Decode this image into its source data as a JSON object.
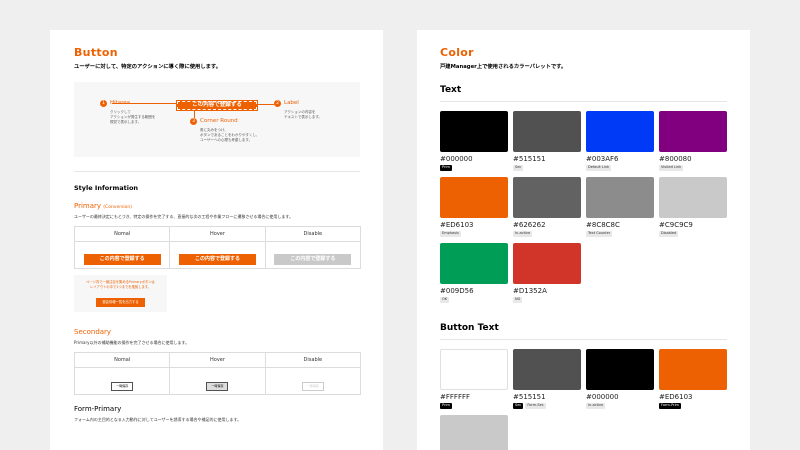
{
  "left": {
    "title": "Button",
    "subtitle": "ユーザーに対して、特定のアクションに導く際に使用します。",
    "demo": {
      "button_label": "この内容で登録する",
      "annotations": [
        {
          "num": "1",
          "title": "Hitarea",
          "desc": "クリックして\nアクションが発生する範囲を\n視覚で表示します。"
        },
        {
          "num": "2",
          "title": "Label",
          "desc": "アクションの内容を\nテキストで表示します。"
        },
        {
          "num": "3",
          "title": "Corner Round",
          "desc": "角に丸みをつけ、\nボタンであることをわかりやすくし、\nユーザーへの心理も考慮します。"
        }
      ]
    },
    "style_info": "Style Information",
    "primary": {
      "title": "Primary",
      "title_note": "(Conversion)",
      "desc": "ユーザーの最終決定にもとづき、特定の操作を完了する、直接的な次の工程や作業フローに遷移させる場合に使用します。",
      "headers": [
        "Nomal",
        "Hover",
        "Disable"
      ],
      "button_label": "この内容で登録する",
      "note": "ページ内で一番注目を集めるPrimaryボタンは\nレイアウトの中で1つまでを推奨します。",
      "note_button": "退会情報一覧を出力する"
    },
    "secondary": {
      "title": "Secondary",
      "desc": "Primary以外の補助機能の操作を完了させる場合に使用します。",
      "headers": [
        "Nomal",
        "Hover",
        "Disable"
      ],
      "button_label": "一時保存"
    },
    "form_primary": {
      "title": "Form-Primary",
      "desc": "フォーム内の主目的となる入力動作に対してユーザーを誘導する場合や補足的に使用します。"
    }
  },
  "right": {
    "title": "Color",
    "subtitle": "戸建Manager上で使用されるカラーパレットです。",
    "text_section": {
      "title": "Text",
      "swatches": [
        {
          "color": "#000000",
          "hex": "#000000",
          "tags": [
            {
              "label": "Prim",
              "dark": true
            }
          ]
        },
        {
          "color": "#515151",
          "hex": "#515151",
          "tags": [
            {
              "label": "Sec",
              "dark": false
            }
          ]
        },
        {
          "color": "#003AF6",
          "hex": "#003AF6",
          "tags": [
            {
              "label": "Default Link",
              "dark": false
            }
          ]
        },
        {
          "color": "#800080",
          "hex": "#800080",
          "tags": [
            {
              "label": "Visited Link",
              "dark": false
            }
          ]
        },
        {
          "color": "#ED6103",
          "hex": "#ED6103",
          "tags": [
            {
              "label": "Emphasis",
              "dark": false
            }
          ]
        },
        {
          "color": "#626262",
          "hex": "#626262",
          "tags": [
            {
              "label": "In-active",
              "dark": false
            }
          ]
        },
        {
          "color": "#8C8C8C",
          "hex": "#8C8C8C",
          "tags": [
            {
              "label": "Text Counter",
              "dark": false
            }
          ]
        },
        {
          "color": "#C9C9C9",
          "hex": "#C9C9C9",
          "tags": [
            {
              "label": "Disabled",
              "dark": false
            }
          ]
        },
        {
          "color": "#009D56",
          "hex": "#009D56",
          "tags": [
            {
              "label": "OK",
              "dark": false
            }
          ]
        },
        {
          "color": "#D1352A",
          "hex": "#D1352A",
          "tags": [
            {
              "label": "NG",
              "dark": false
            }
          ]
        }
      ]
    },
    "button_text_section": {
      "title": "Button Text",
      "swatches": [
        {
          "color": "#FFFFFF",
          "hex": "#FFFFFF",
          "bordered": true,
          "tags": [
            {
              "label": "Prim",
              "dark": true
            }
          ]
        },
        {
          "color": "#515151",
          "hex": "#515151",
          "tags": [
            {
              "label": "Sec",
              "dark": true
            },
            {
              "label": "Form-Sec",
              "dark": false
            }
          ]
        },
        {
          "color": "#000000",
          "hex": "#000000",
          "tags": [
            {
              "label": "In-active",
              "dark": false
            }
          ]
        },
        {
          "color": "#ED6103",
          "hex": "#ED6103",
          "tags": [
            {
              "label": "Form-Prim",
              "dark": true
            }
          ]
        },
        {
          "color": "#C9C9C9",
          "hex": "",
          "tags": []
        }
      ]
    }
  }
}
